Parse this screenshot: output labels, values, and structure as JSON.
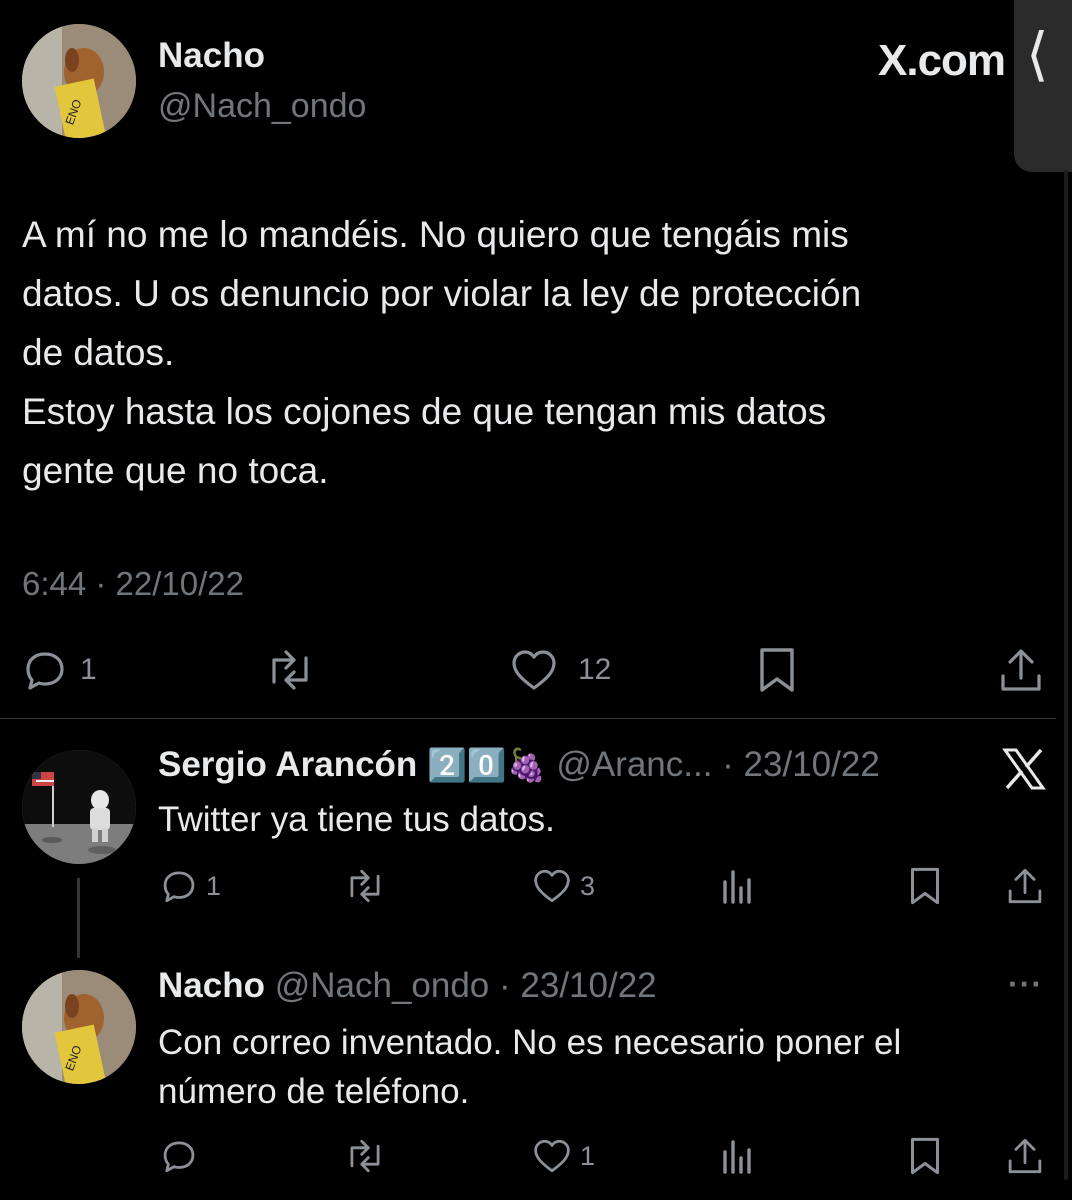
{
  "colors": {
    "background": "#000000",
    "text": "#e7e9ea",
    "muted": "#71767b",
    "divider": "#2f3336"
  },
  "header": {
    "brand": "X.com",
    "side_tab_glyph": "⟨"
  },
  "main_post": {
    "name": "Nacho",
    "handle": "@Nach_ondo",
    "text_lines": [
      "A mí no me lo mandéis. No quiero que tengáis mis",
      "datos. U os denuncio por violar la ley de protección",
      "de datos.",
      "Estoy hasta los cojones de que tengan mis datos",
      "gente que no toca."
    ],
    "timestamp": "6:44 · 22/10/22",
    "replies": "1",
    "likes": "12",
    "icons": [
      "reply-icon",
      "repost-icon",
      "like-icon",
      "bookmark-icon",
      "share-icon"
    ]
  },
  "reply_1": {
    "name": "Sergio Arancón",
    "badges": "2️⃣0️⃣🍇",
    "handle": "@Aranc...",
    "date": " · 23/10/22",
    "text": "Twitter ya tiene tus datos.",
    "replies": "1",
    "likes": "3",
    "icons": [
      "reply-icon",
      "repost-icon",
      "like-icon",
      "views-icon",
      "bookmark-icon",
      "share-icon",
      "x-logo-icon"
    ]
  },
  "reply_2": {
    "name": "Nacho",
    "handle": "@Nach_ondo",
    "date": " · 23/10/22",
    "text_lines": [
      "Con correo inventado. No es necesario poner el",
      "número de teléfono."
    ],
    "likes": "1",
    "more": "···",
    "icons": [
      "reply-icon",
      "repost-icon",
      "like-icon",
      "views-icon",
      "bookmark-icon",
      "share-icon",
      "more-icon"
    ]
  }
}
